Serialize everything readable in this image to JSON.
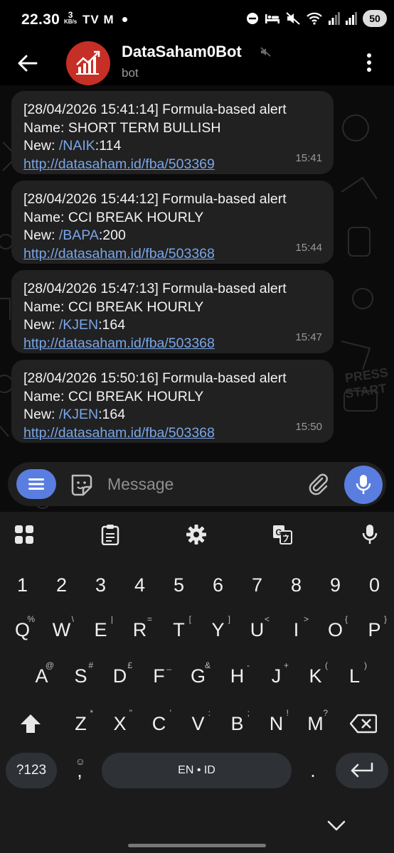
{
  "status_bar": {
    "time": "22.30",
    "net_speed_value": "3",
    "net_speed_unit": "KB/s",
    "app_icons": "TV M",
    "battery": "50"
  },
  "header": {
    "title": "DataSaham0Bot",
    "subtitle": "bot"
  },
  "messages": [
    {
      "line1": "[28/04/2026 15:41:14] Formula-based alert",
      "line2": "Name: SHORT TERM BULLISH",
      "new_prefix": "New: ",
      "command": "/NAIK",
      "value": ":114",
      "link": "http://datasaham.id/fba/503369",
      "time": "15:41"
    },
    {
      "line1": "[28/04/2026 15:44:12] Formula-based alert",
      "line2": "Name: CCI BREAK HOURLY",
      "new_prefix": "New: ",
      "command": "/BAPA",
      "value": ":200",
      "link": "http://datasaham.id/fba/503368",
      "time": "15:44"
    },
    {
      "line1": "[28/04/2026 15:47:13] Formula-based alert",
      "line2": "Name: CCI BREAK HOURLY",
      "new_prefix": "New: ",
      "command": "/KJEN",
      "value": ":164",
      "link": "http://datasaham.id/fba/503368",
      "time": "15:47"
    },
    {
      "line1": "[28/04/2026 15:50:16] Formula-based alert",
      "line2": "Name: CCI BREAK HOURLY",
      "new_prefix": "New: ",
      "command": "/KJEN",
      "value": ":164",
      "link": "http://datasaham.id/fba/503368",
      "time": "15:50"
    }
  ],
  "composer": {
    "placeholder": "Message"
  },
  "keyboard": {
    "number_row": [
      "1",
      "2",
      "3",
      "4",
      "5",
      "6",
      "7",
      "8",
      "9",
      "0"
    ],
    "row1": [
      {
        "key": "Q",
        "hint": "%"
      },
      {
        "key": "W",
        "hint": "\\"
      },
      {
        "key": "E",
        "hint": "|"
      },
      {
        "key": "R",
        "hint": "="
      },
      {
        "key": "T",
        "hint": "["
      },
      {
        "key": "Y",
        "hint": "]"
      },
      {
        "key": "U",
        "hint": "<"
      },
      {
        "key": "I",
        "hint": ">"
      },
      {
        "key": "O",
        "hint": "{"
      },
      {
        "key": "P",
        "hint": "}"
      }
    ],
    "row2": [
      {
        "key": "A",
        "hint": "@"
      },
      {
        "key": "S",
        "hint": "#"
      },
      {
        "key": "D",
        "hint": "£"
      },
      {
        "key": "F",
        "hint": "_"
      },
      {
        "key": "G",
        "hint": "&"
      },
      {
        "key": "H",
        "hint": "-"
      },
      {
        "key": "J",
        "hint": "+"
      },
      {
        "key": "K",
        "hint": "("
      },
      {
        "key": "L",
        "hint": ")"
      }
    ],
    "row3": [
      {
        "key": "Z",
        "hint": "*"
      },
      {
        "key": "X",
        "hint": "\""
      },
      {
        "key": "C",
        "hint": "'"
      },
      {
        "key": "V",
        "hint": ":"
      },
      {
        "key": "B",
        "hint": ";"
      },
      {
        "key": "N",
        "hint": "!"
      },
      {
        "key": "M",
        "hint": "?"
      }
    ],
    "symbols_key": "?123",
    "comma_key": ",",
    "emoji_hint": "☺",
    "space_label": "EN • ID",
    "period_key": "."
  },
  "icons": {
    "back": "arrow-left-icon",
    "mute": "speaker-muted-icon",
    "more": "more-vertical-icon",
    "menu": "menu-lines-icon",
    "sticker": "sticker-icon",
    "attach": "paperclip-icon",
    "mic": "microphone-icon",
    "apps_grid": "grid-icon",
    "clipboard": "clipboard-icon",
    "settings": "gear-icon",
    "translate": "translate-icon",
    "voice": "microphone-icon",
    "shift": "shift-arrow-icon",
    "backspace": "backspace-icon",
    "enter": "enter-icon",
    "hide": "chevron-down-icon"
  },
  "colors": {
    "accent": "#5a7de0",
    "link": "#7aa6e8",
    "avatar_bg": "#c62f26",
    "bubble_bg": "#212121"
  }
}
